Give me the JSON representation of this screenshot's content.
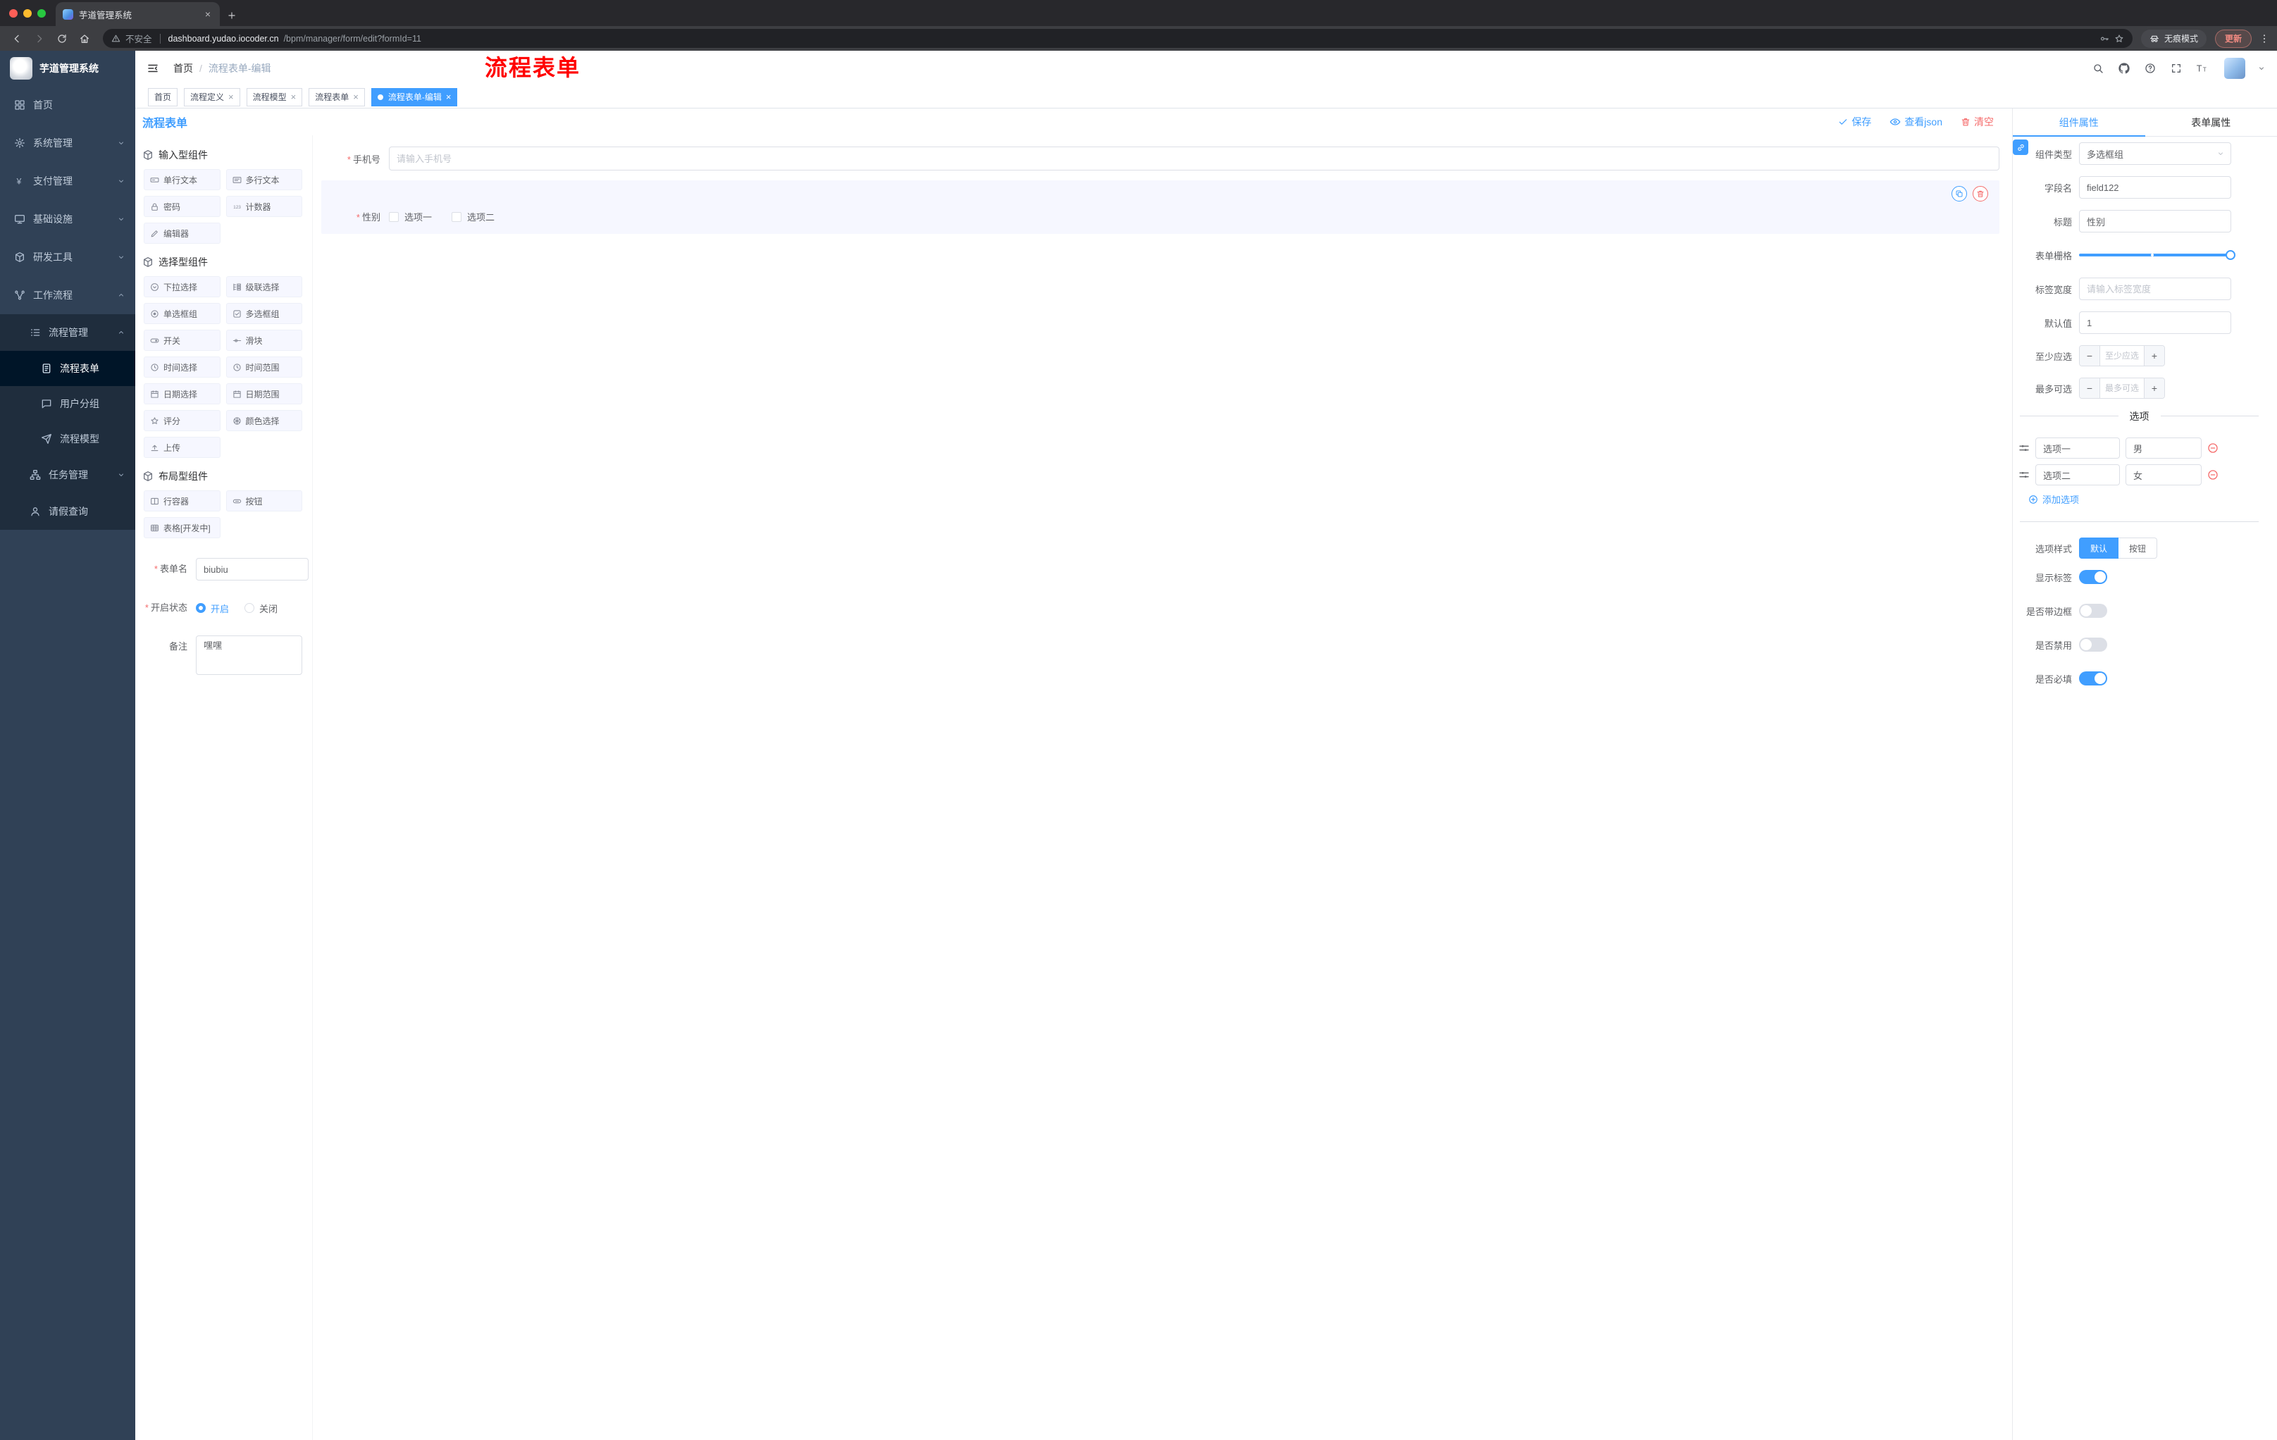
{
  "colors": {
    "primary": "#409eff",
    "danger": "#f56c6c",
    "annotation_red": "#ff0000",
    "sidebar_bg": "#304156",
    "sidebar_submenu_bg": "#1f2d3d",
    "tag_active_bg": "#409eff",
    "selected_field_bg": "#f6f7ff"
  },
  "browser": {
    "tab_title": "芋道管理系统",
    "security_label": "不安全",
    "url_host": "dashboard.yudao.iocoder.cn",
    "url_path": "/bpm/manager/form/edit?formId=11",
    "incognito_label": "无痕模式",
    "update_label": "更新"
  },
  "sidebar": {
    "logo_title": "芋道管理系统",
    "menu": [
      {
        "label": "首页"
      },
      {
        "label": "系统管理"
      },
      {
        "label": "支付管理"
      },
      {
        "label": "基础设施"
      },
      {
        "label": "研发工具"
      },
      {
        "label": "工作流程"
      },
      {
        "label": "流程管理"
      },
      {
        "label": "流程表单"
      },
      {
        "label": "用户分组"
      },
      {
        "label": "流程模型"
      },
      {
        "label": "任务管理"
      },
      {
        "label": "请假查询"
      }
    ]
  },
  "header": {
    "breadcrumb": {
      "home": "首页",
      "current": "流程表单-编辑"
    },
    "annotation": "流程表单"
  },
  "tags": [
    {
      "label": "首页"
    },
    {
      "label": "流程定义"
    },
    {
      "label": "流程模型"
    },
    {
      "label": "流程表单"
    },
    {
      "label": "流程表单-编辑"
    }
  ],
  "designer": {
    "title": "流程表单",
    "actions": {
      "save": "保存",
      "view_json": "查看json",
      "clear": "清空"
    },
    "palette": {
      "sections": [
        {
          "title": "输入型组件",
          "items": [
            "单行文本",
            "多行文本",
            "密码",
            "计数器",
            "编辑器"
          ]
        },
        {
          "title": "选择型组件",
          "items": [
            "下拉选择",
            "级联选择",
            "单选框组",
            "多选框组",
            "开关",
            "滑块",
            "时间选择",
            "时间范围",
            "日期选择",
            "日期范围",
            "评分",
            "颜色选择",
            "上传"
          ]
        },
        {
          "title": "布局型组件",
          "items": [
            "行容器",
            "按钮",
            "表格[开发中]"
          ]
        }
      ]
    },
    "meta": {
      "name_label": "表单名",
      "name_value": "biubiu",
      "status_label": "开启状态",
      "status_on": "开启",
      "status_off": "关闭",
      "remark_label": "备注",
      "remark_value": "嘿嘿"
    },
    "canvas": {
      "phone": {
        "label": "手机号",
        "placeholder": "请输入手机号"
      },
      "gender": {
        "label": "性别",
        "option1": "选项一",
        "option2": "选项二"
      }
    }
  },
  "props": {
    "tabs": {
      "component": "组件属性",
      "form": "表单属性"
    },
    "rows": {
      "type_label": "组件类型",
      "type_value": "多选框组",
      "field_label": "字段名",
      "field_value": "field122",
      "title_label": "标题",
      "title_value": "性别",
      "grid_label": "表单栅格",
      "width_label": "标签宽度",
      "width_placeholder": "请输入标签宽度",
      "default_label": "默认值",
      "default_value": "1",
      "min_label": "至少应选",
      "min_placeholder": "至少应选",
      "max_label": "最多可选",
      "max_placeholder": "最多可选"
    },
    "options": {
      "divider_title": "选项",
      "rows": [
        {
          "label": "选项一",
          "value": "男"
        },
        {
          "label": "选项二",
          "value": "女"
        }
      ],
      "add_label": "添加选项"
    },
    "style": {
      "label": "选项样式",
      "default": "默认",
      "button": "按钮"
    },
    "switches": [
      {
        "label": "显示标签",
        "on": true
      },
      {
        "label": "是否带边框",
        "on": false
      },
      {
        "label": "是否禁用",
        "on": false
      },
      {
        "label": "是否必填",
        "on": true
      }
    ]
  }
}
